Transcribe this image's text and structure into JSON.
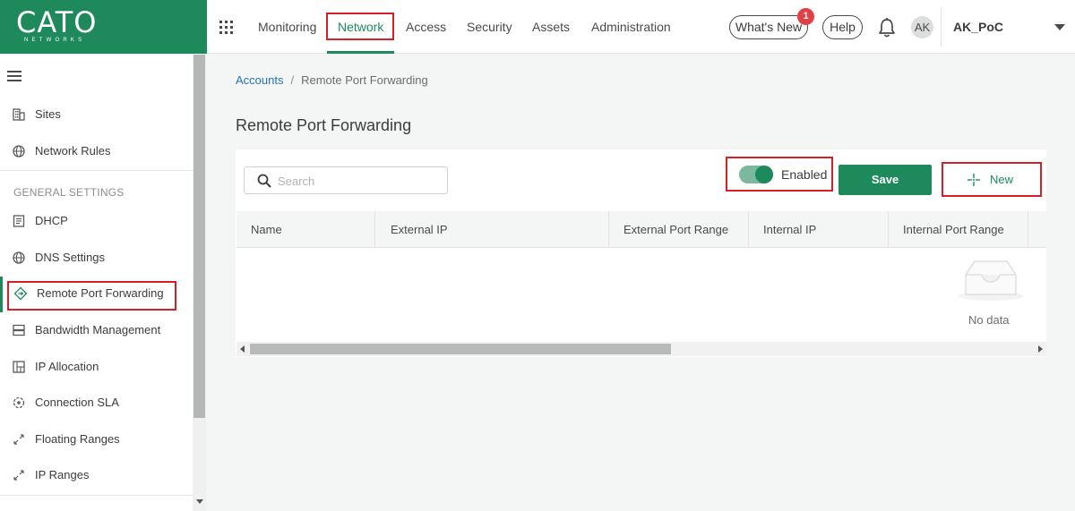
{
  "brand": {
    "name": "CATO",
    "sub": "NETWORKS"
  },
  "nav": {
    "tabs": [
      {
        "label": "Monitoring"
      },
      {
        "label": "Network"
      },
      {
        "label": "Access"
      },
      {
        "label": "Security"
      },
      {
        "label": "Assets"
      },
      {
        "label": "Administration"
      }
    ],
    "active_tab": "Network",
    "whats_new": "What's New",
    "whats_new_badge": "1",
    "help": "Help",
    "avatar_initials": "AK",
    "account_name": "AK_PoC"
  },
  "sidebar": {
    "top_items": [
      {
        "label": "Sites",
        "icon": "building-icon"
      },
      {
        "label": "Network Rules",
        "icon": "globe-icon"
      }
    ],
    "section_heading": "GENERAL SETTINGS",
    "items": [
      {
        "label": "DHCP",
        "icon": "document-icon"
      },
      {
        "label": "DNS Settings",
        "icon": "globe-icon"
      },
      {
        "label": "Remote Port Forwarding",
        "icon": "diamond-arrow-icon",
        "active": true
      },
      {
        "label": "Bandwidth Management",
        "icon": "stack-icon"
      },
      {
        "label": "IP Allocation",
        "icon": "grid-icon"
      },
      {
        "label": "Connection SLA",
        "icon": "target-icon"
      },
      {
        "label": "Floating Ranges",
        "icon": "expand-arrows-icon"
      },
      {
        "label": "IP Ranges",
        "icon": "expand-arrows-icon"
      }
    ]
  },
  "breadcrumb": {
    "parent": "Accounts",
    "separator": "/",
    "current": "Remote Port Forwarding"
  },
  "page": {
    "title": "Remote Port Forwarding"
  },
  "toolbar": {
    "search_placeholder": "Search",
    "search_value": "",
    "toggle_label": "Enabled",
    "toggle_on": true,
    "save_label": "Save",
    "new_label": "New"
  },
  "table": {
    "columns": [
      "Name",
      "External IP",
      "External Port Range",
      "Internal IP",
      "Internal Port Range"
    ],
    "rows": [],
    "empty_text": "No data"
  },
  "colors": {
    "brand": "#1e8a5c",
    "highlight": "#d71f2a",
    "link": "#2474b8",
    "badge": "#e14045"
  }
}
